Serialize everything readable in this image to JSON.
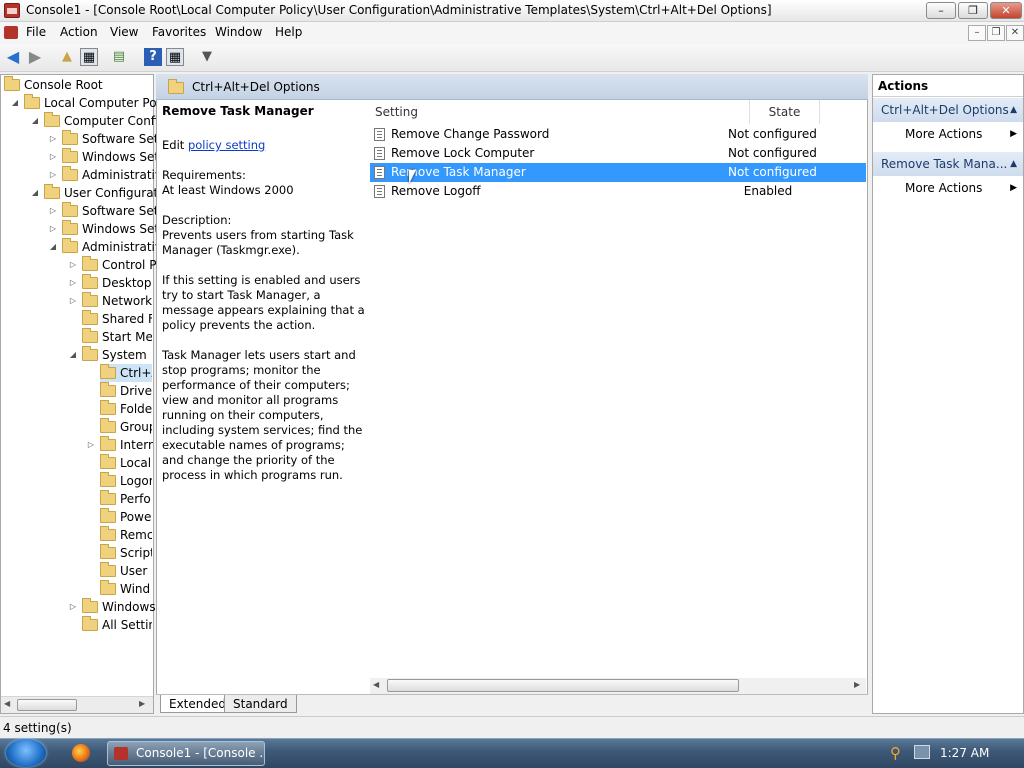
{
  "window": {
    "title": "Console1 - [Console Root\\Local Computer Policy\\User Configuration\\Administrative Templates\\System\\Ctrl+Alt+Del Options]"
  },
  "menu": [
    "File",
    "Action",
    "View",
    "Favorites",
    "Window",
    "Help"
  ],
  "tree": [
    {
      "label": "Console Root"
    },
    {
      "label": "Local Computer Poli"
    },
    {
      "label": "Computer Confi"
    },
    {
      "label": "Software Setti"
    },
    {
      "label": "Windows Setti"
    },
    {
      "label": "Administrativ"
    },
    {
      "label": "User Configurati"
    },
    {
      "label": "Software Setti"
    },
    {
      "label": "Windows Setti"
    },
    {
      "label": "Administrativ"
    },
    {
      "label": "Control P"
    },
    {
      "label": "Desktop"
    },
    {
      "label": "Network"
    },
    {
      "label": "Shared Fo"
    },
    {
      "label": "Start Mer"
    },
    {
      "label": "System"
    },
    {
      "label": "Ctrl+A"
    },
    {
      "label": "Driver"
    },
    {
      "label": "Folde"
    },
    {
      "label": "Group"
    },
    {
      "label": "Interr"
    },
    {
      "label": "Local"
    },
    {
      "label": "Logor"
    },
    {
      "label": "Perfo"
    },
    {
      "label": "Powe"
    },
    {
      "label": "Remc"
    },
    {
      "label": "Script"
    },
    {
      "label": "User F"
    },
    {
      "label": "Wind"
    },
    {
      "label": "Windows"
    },
    {
      "label": "All Settin"
    }
  ],
  "center": {
    "header": "Ctrl+Alt+Del Options",
    "desc_title": "Remove Task Manager",
    "edit_prefix": "Edit",
    "edit_link": "policy setting",
    "req_label": "Requirements:",
    "req_value": "At least Windows 2000",
    "desc_label": "Description:",
    "desc_p1": "Prevents users from starting Task Manager (Taskmgr.exe).",
    "desc_p2": "If this setting is enabled and users try to start Task Manager, a message appears explaining that a policy prevents the action.",
    "desc_p3": "Task Manager lets users start and stop programs; monitor the performance of their computers; view and monitor all programs running on their computers, including system services; find the executable names of programs; and change the priority of the process in which programs run.",
    "col_setting": "Setting",
    "col_state": "State",
    "rows": [
      {
        "setting": "Remove Change Password",
        "state": "Not configured"
      },
      {
        "setting": "Remove Lock Computer",
        "state": "Not configured"
      },
      {
        "setting": "Remove Task Manager",
        "state": "Not configured"
      },
      {
        "setting": "Remove Logoff",
        "state": "Enabled"
      }
    ],
    "tab_extended": "Extended",
    "tab_standard": "Standard"
  },
  "actions": {
    "title": "Actions",
    "group1": "Ctrl+Alt+Del Options",
    "group1_item": "More Actions",
    "group2": "Remove Task Mana...",
    "group2_item": "More Actions"
  },
  "status": "4 setting(s)",
  "taskbar": {
    "task_label": "Console1 - [Console ...",
    "clock": "1:27 AM"
  }
}
